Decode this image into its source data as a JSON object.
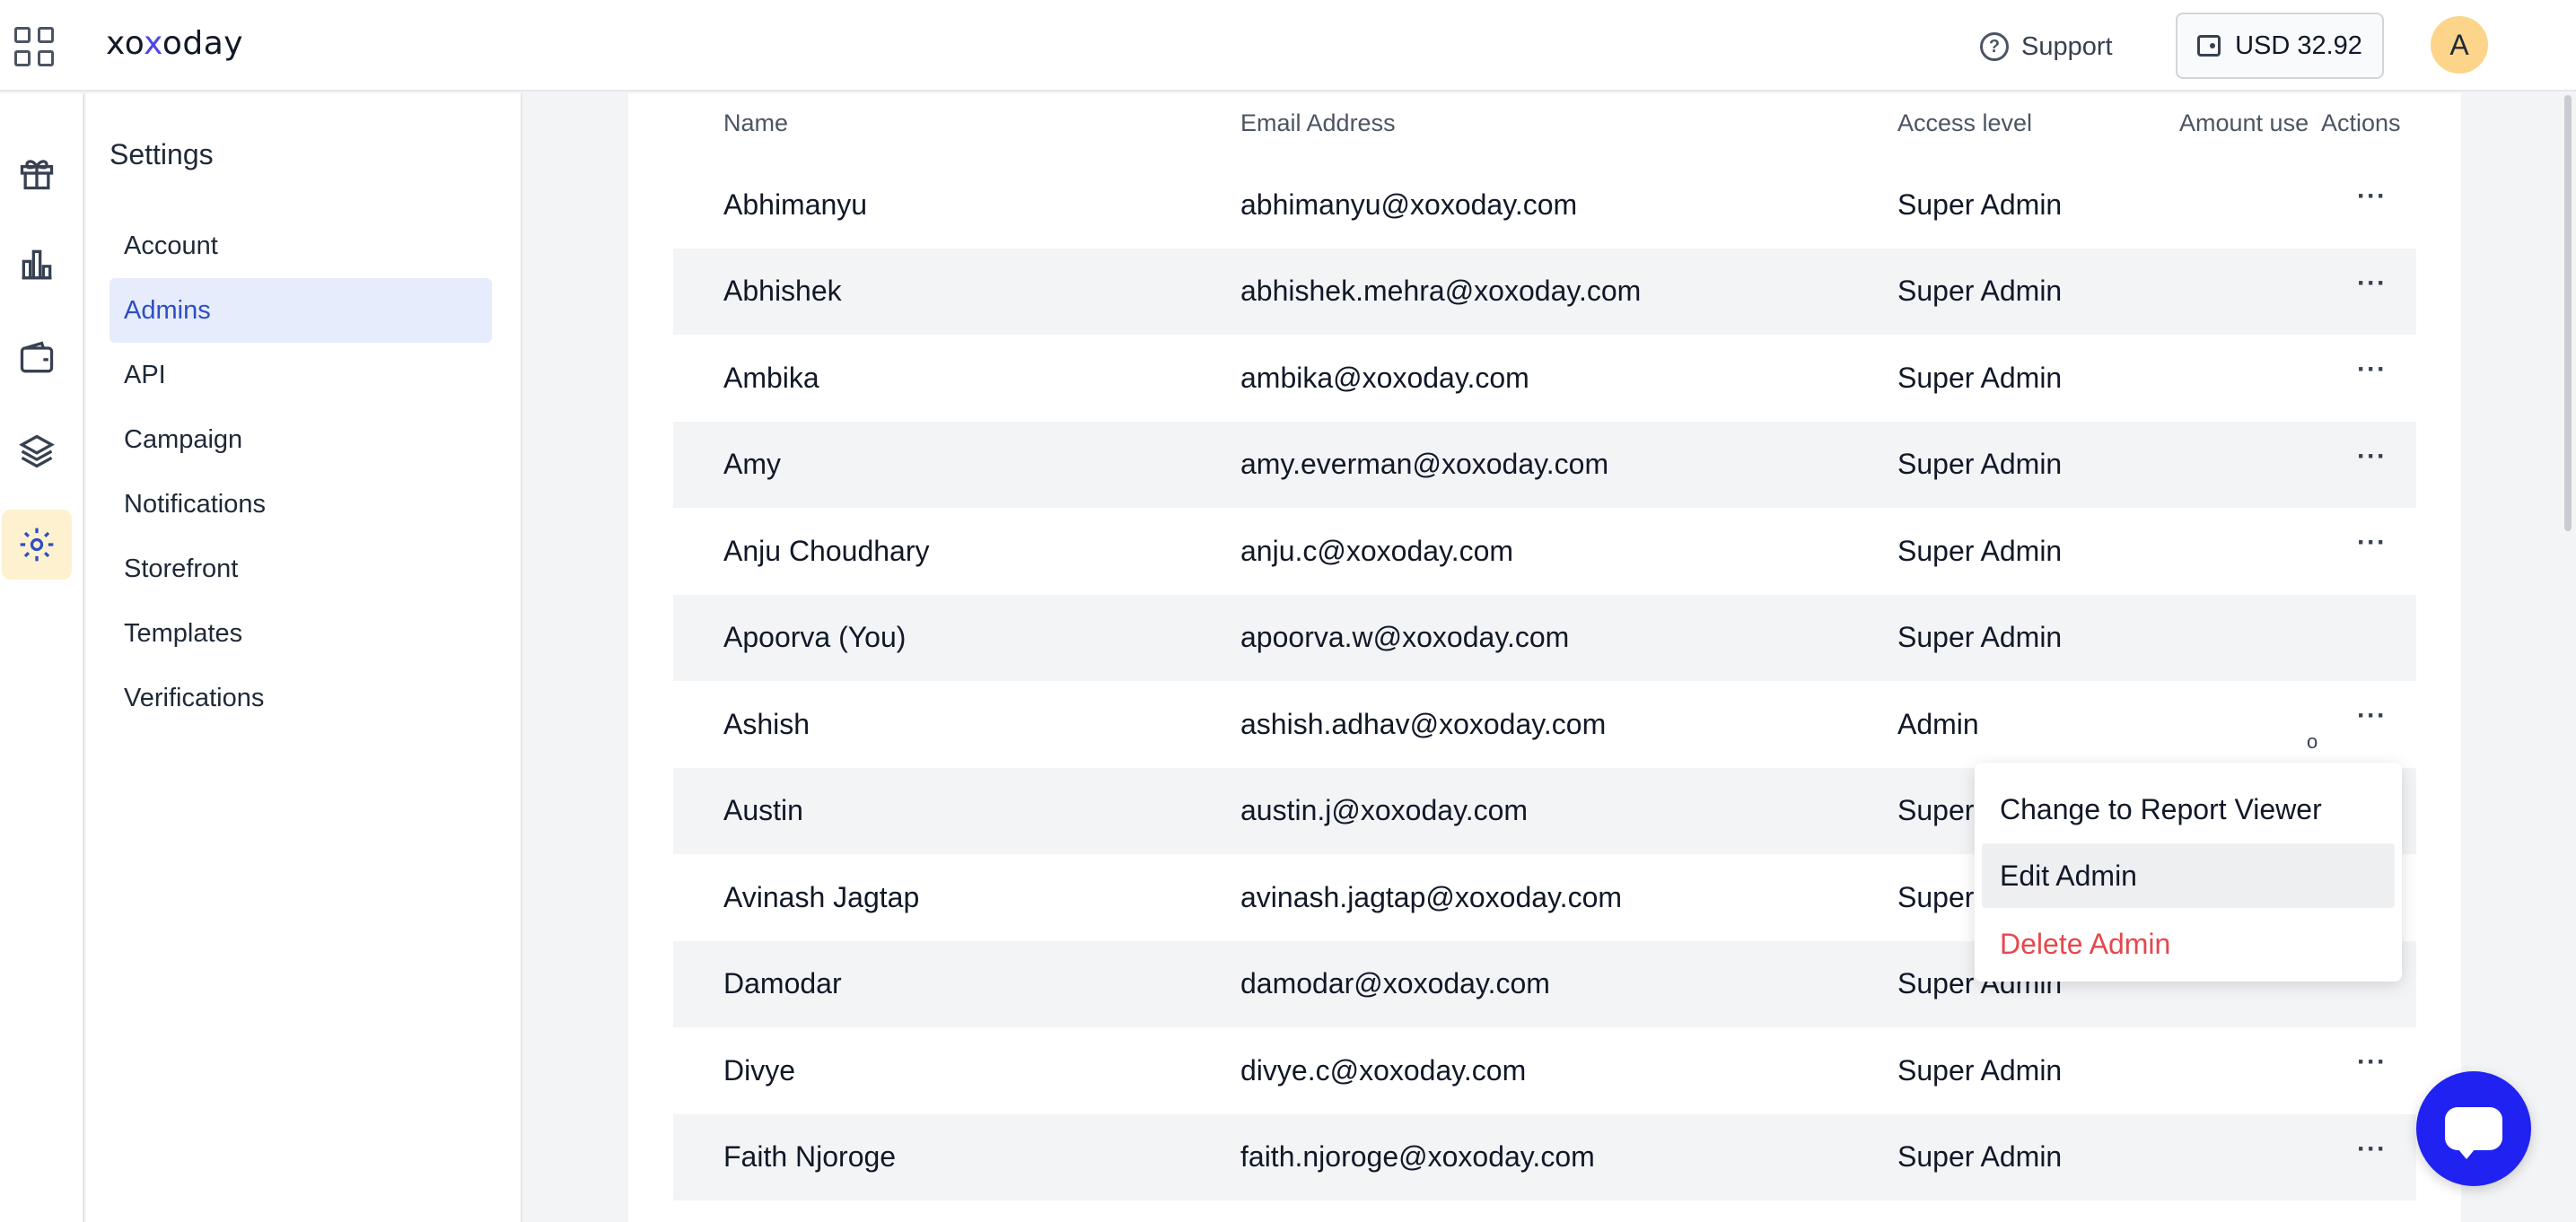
{
  "topbar": {
    "logo": {
      "before": "xo",
      "x": "x",
      "after": "oday"
    },
    "support_label": "Support",
    "wallet_label": "USD 32.92",
    "avatar_initial": "A"
  },
  "rail": {
    "items": [
      {
        "icon": "gift-icon",
        "active": false
      },
      {
        "icon": "bar-chart-icon",
        "active": false
      },
      {
        "icon": "wallet-icon",
        "active": false
      },
      {
        "icon": "layers-icon",
        "active": false
      },
      {
        "icon": "gear-icon",
        "active": true
      }
    ]
  },
  "settings": {
    "title": "Settings",
    "items": [
      {
        "label": "Account",
        "active": false
      },
      {
        "label": "Admins",
        "active": true
      },
      {
        "label": "API",
        "active": false
      },
      {
        "label": "Campaign",
        "active": false
      },
      {
        "label": "Notifications",
        "active": false
      },
      {
        "label": "Storefront",
        "active": false
      },
      {
        "label": "Templates",
        "active": false
      },
      {
        "label": "Verifications",
        "active": false
      }
    ]
  },
  "table": {
    "headers": {
      "name": "Name",
      "email": "Email Address",
      "access": "Access level",
      "amount": "Amount use",
      "actions": "Actions"
    },
    "rows": [
      {
        "name": "Abhimanyu",
        "email": "abhimanyu@xoxoday.com",
        "access": "Super Admin",
        "actions": "···"
      },
      {
        "name": "Abhishek",
        "email": "abhishek.mehra@xoxoday.com",
        "access": "Super Admin",
        "actions": "···"
      },
      {
        "name": "Ambika",
        "email": "ambika@xoxoday.com",
        "access": "Super Admin",
        "actions": "···"
      },
      {
        "name": "Amy",
        "email": "amy.everman@xoxoday.com",
        "access": "Super Admin",
        "actions": "···"
      },
      {
        "name": "Anju Choudhary",
        "email": "anju.c@xoxoday.com",
        "access": "Super Admin",
        "actions": "···"
      },
      {
        "name": "Apoorva (You)",
        "email": "apoorva.w@xoxoday.com",
        "access": "Super Admin",
        "actions": ""
      },
      {
        "name": "Ashish",
        "email": "ashish.adhav@xoxoday.com",
        "access": "Admin",
        "actions": "···"
      },
      {
        "name": "Austin",
        "email": "austin.j@xoxoday.com",
        "access": "Super Admin",
        "actions": ""
      },
      {
        "name": "Avinash Jagtap",
        "email": "avinash.jagtap@xoxoday.com",
        "access": "Super Admin",
        "actions": ""
      },
      {
        "name": "Damodar",
        "email": "damodar@xoxoday.com",
        "access": "Super Admin",
        "actions": ""
      },
      {
        "name": "Divye",
        "email": "divye.c@xoxoday.com",
        "access": "Super Admin",
        "actions": "···"
      },
      {
        "name": "Faith Njoroge",
        "email": "faith.njoroge@xoxoday.com",
        "access": "Super Admin",
        "actions": "···"
      }
    ]
  },
  "action_menu": {
    "items": [
      {
        "label": "Change to Report Viewer",
        "variant": "default"
      },
      {
        "label": "Edit Admin",
        "variant": "hover"
      },
      {
        "label": "Delete Admin",
        "variant": "danger"
      }
    ],
    "cursor_text": "o"
  },
  "colors": {
    "accent": "#2e4ec2",
    "active_nav_bg": "#e6ecfb",
    "rail_active_bg": "#fdf1cf",
    "danger": "#e5484d",
    "chat_button": "#1f22f0",
    "avatar_bg": "#fcd58a"
  }
}
